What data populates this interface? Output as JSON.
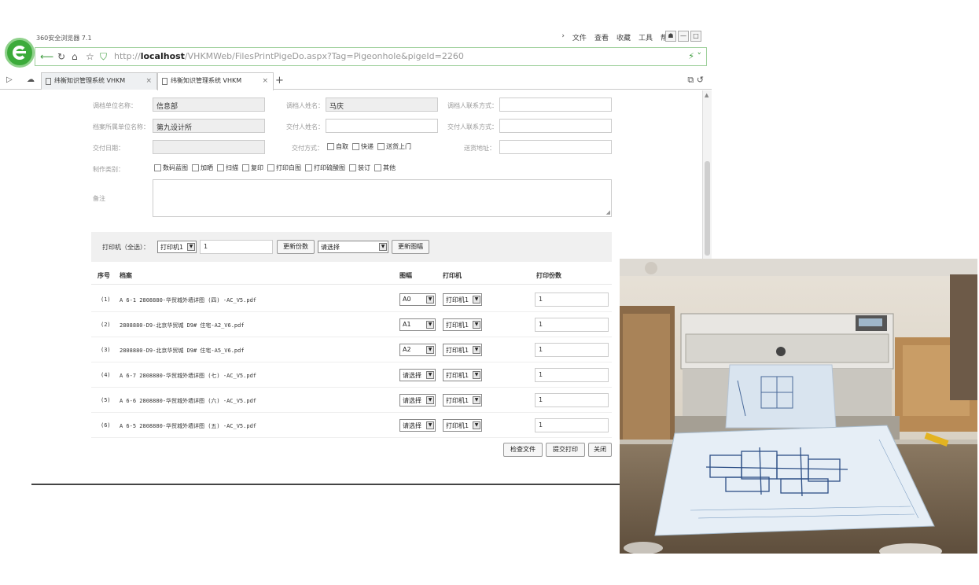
{
  "browser": {
    "app_title": "360安全浏览器 7.1",
    "menu": [
      "文件",
      "查看",
      "收藏",
      "工具",
      "帮助"
    ],
    "window_buttons": [
      "☗",
      "—",
      "□"
    ],
    "url_prefix": "http://",
    "url_host": "localhost",
    "url_path": "/VHKMWeb/FilesPrintPigeDo.aspx?Tag=Pigeonhole&pigeId=2260",
    "tabs": [
      {
        "label": "纬衡知识管理系统 VHKM",
        "active": false
      },
      {
        "label": "纬衡知识管理系统 VHKM",
        "active": true
      }
    ]
  },
  "form": {
    "req_unit_label": "调档单位名称：",
    "req_unit_value": "信息部",
    "req_person_label": "调档人姓名：",
    "req_person_value": "马庆",
    "req_contact_label": "调档人联系方式：",
    "req_contact_value": "",
    "archive_unit_label": "档案所属单位名称：",
    "archive_unit_value": "第九设计所",
    "deliver_person_label": "交付人姓名：",
    "deliver_person_value": "",
    "deliver_contact_label": "交付人联系方式：",
    "deliver_contact_value": "",
    "deliver_date_label": "交付日期：",
    "deliver_date_value": "",
    "deliver_method_label": "交付方式：",
    "deliver_methods": [
      "自取",
      "快递",
      "送货上门"
    ],
    "address_label": "送货地址：",
    "address_value": "",
    "make_type_label": "制作类别：",
    "make_types": [
      "数码蓝图",
      "加晒",
      "扫描",
      "复印",
      "打印白图",
      "打印硫酸图",
      "装订",
      "其他"
    ],
    "memo_label": "备注"
  },
  "toolbar": {
    "label": "打印机（全选）：",
    "printer_select": "打印机1",
    "copies_value": "1",
    "update_copies_btn": "更新份数",
    "size_select": "请选择",
    "update_size_btn": "更新图幅"
  },
  "table": {
    "headers": {
      "no": "序号",
      "file": "档案",
      "size": "图幅",
      "printer": "打印机",
      "copies": "打印份数"
    },
    "rows": [
      {
        "no": "(1)",
        "file": "A 6-1 2808880-华贸城外墙详图 (四) -AC_V5.pdf",
        "size": "A0",
        "printer": "打印机1",
        "copies": "1"
      },
      {
        "no": "(2)",
        "file": "2808880-D9-北京华贸城 D9# 住宅-A2_V6.pdf",
        "size": "A1",
        "printer": "打印机1",
        "copies": "1"
      },
      {
        "no": "(3)",
        "file": "2808880-D9-北京华贸城 D9# 住宅-A5_V6.pdf",
        "size": "A2",
        "printer": "打印机1",
        "copies": "1"
      },
      {
        "no": "(4)",
        "file": "A 6-7 2808880-华贸城外墙详图 (七) -AC_V5.pdf",
        "size": "请选择",
        "printer": "打印机1",
        "copies": "1"
      },
      {
        "no": "(5)",
        "file": "A 6-6 2808880-华贸城外墙详图 (六) -AC_V5.pdf",
        "size": "请选择",
        "printer": "打印机1",
        "copies": "1"
      },
      {
        "no": "(6)",
        "file": "A 6-5 2808880-华贸城外墙详图 (五) -AC_V5.pdf",
        "size": "请选择",
        "printer": "打印机1",
        "copies": "1"
      }
    ]
  },
  "actions": {
    "check_files": "检查文件",
    "submit_print": "提交打印",
    "close": "关闭"
  },
  "colors": {
    "brand_green": "#3cab3a",
    "border_gray": "#cccccc",
    "toolbar_bg": "#f0f0f0"
  }
}
